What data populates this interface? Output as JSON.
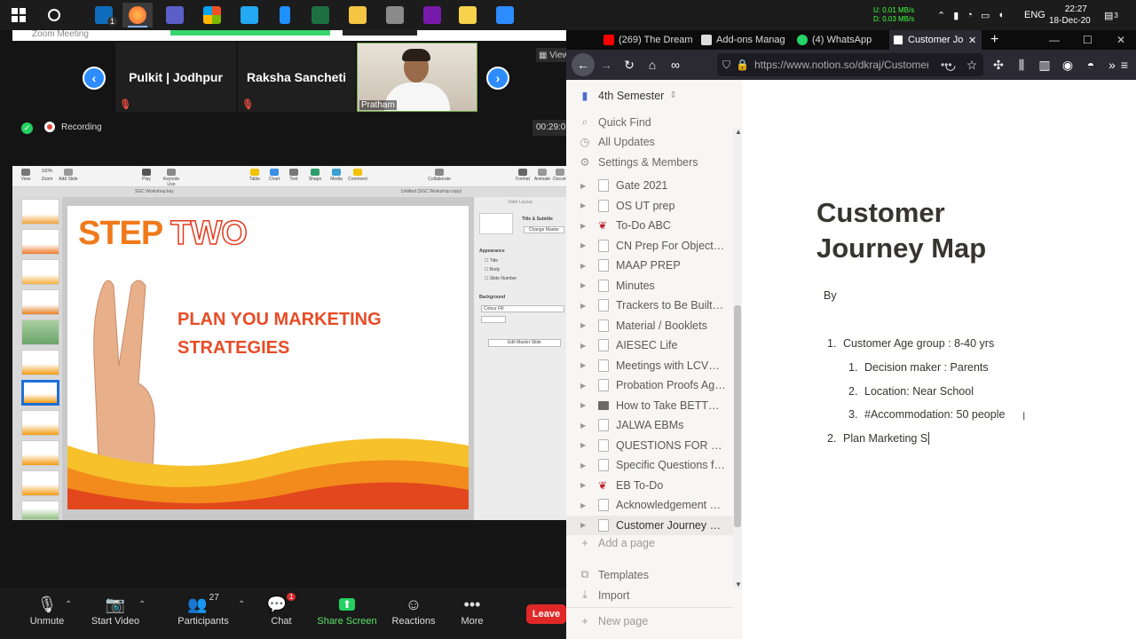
{
  "taskbar": {
    "net_up": "U:    0.01 MB/s",
    "net_down": "D:    0.03 MB/s",
    "language": "ENG",
    "time": "22:27",
    "date": "18-Dec-20",
    "notif_count": "3",
    "outlook_badge": "1"
  },
  "zoom": {
    "window_title": "Zoom Meeting",
    "view_label": "View",
    "participants": [
      {
        "name": "Pulkit | Jodhpur"
      },
      {
        "name": "Raksha Sancheti"
      }
    ],
    "video_participant": "Pratham",
    "recording_label": "Recording",
    "timer": "00:29:0",
    "controls": {
      "unmute": "Unmute",
      "start_video": "Start Video",
      "participants": "Participants",
      "participant_count": "27",
      "chat": "Chat",
      "chat_badge": "1",
      "share_screen": "Share Screen",
      "reactions": "Reactions",
      "more": "More",
      "leave": "Leave"
    }
  },
  "keynote": {
    "toolbar": {
      "view": "View",
      "zoom": "Zoom",
      "zoom_value": "100%",
      "add_slide": "Add Slide",
      "play": "Play",
      "keynote_live": "Keynote Live",
      "table": "Table",
      "chart": "Chart",
      "text": "Text",
      "shape": "Shape",
      "media": "Media",
      "comment": "Comment",
      "collaborate": "Collaborate",
      "format": "Format",
      "animate": "Animate",
      "document": "Docum"
    },
    "tabs": [
      "SGC Workshop.key",
      "Untitled (SGC Workshop copy)"
    ],
    "slide": {
      "title_part1": "STEP",
      "title_part2": "TWO",
      "body_line1": "PLAN YOU MARKETING",
      "body_line2": "STRATEGIES"
    },
    "inspector": {
      "header": "Slide Layout",
      "master": "Title & Subtitle",
      "change_master": "Change Master",
      "appearance": "Appearance",
      "title": "Title",
      "body": "Body",
      "slide_number": "Slide Number",
      "background": "Background",
      "fill": "Colour Fill",
      "edit_master": "Edit Master Slide"
    }
  },
  "firefox": {
    "tabs": [
      {
        "label": "(269) The Dream"
      },
      {
        "label": "Add-ons Manag"
      },
      {
        "label": "(4) WhatsApp"
      },
      {
        "label": "Customer Jo"
      }
    ],
    "url": "https://www.notion.so/dkraj/Customer"
  },
  "notion": {
    "workspace": "4th Semester",
    "quick_find": "Quick Find",
    "all_updates": "All Updates",
    "settings": "Settings & Members",
    "pages": [
      {
        "label": "Gate 2021",
        "icon": "page"
      },
      {
        "label": "OS UT prep",
        "icon": "page"
      },
      {
        "label": "To-Do ABC",
        "icon": "bow"
      },
      {
        "label": "CN Prep For Objective",
        "icon": "page"
      },
      {
        "label": "MAAP PREP",
        "icon": "page"
      },
      {
        "label": "Minutes",
        "icon": "page"
      },
      {
        "label": "Trackers to Be Built for",
        "icon": "page"
      },
      {
        "label": "Material / Booklets",
        "icon": "page"
      },
      {
        "label": "AIESEC Life",
        "icon": "page"
      },
      {
        "label": "Meetings with LCVP P...",
        "icon": "page"
      },
      {
        "label": "Probation Proofs Agai...",
        "icon": "page"
      },
      {
        "label": "How to Take BETTER ...",
        "icon": "image"
      },
      {
        "label": "JALWA EBMs",
        "icon": "page"
      },
      {
        "label": "QUESTIONS FOR LCV...",
        "icon": "page"
      },
      {
        "label": "Specific Questions for...",
        "icon": "page"
      },
      {
        "label": "EB To-Do",
        "icon": "bow"
      },
      {
        "label": "Acknowledgement of ...",
        "icon": "page"
      },
      {
        "label": "Customer Journey M...",
        "icon": "page"
      }
    ],
    "add_page": "Add a page",
    "templates": "Templates",
    "import": "Import",
    "new_page": "New page",
    "page_title_line1": "Customer",
    "page_title_line2": "Journey Map",
    "by": "By",
    "list": [
      {
        "num": "1.",
        "text": "Customer Age group : 8-40 yrs"
      },
      {
        "num": "1.",
        "text": "Decision maker : Parents"
      },
      {
        "num": "2.",
        "text": "Location: Near School"
      },
      {
        "num": "3.",
        "text": "#Accommodation: 50 people"
      },
      {
        "num": "2.",
        "text": "Plan Marketing S"
      }
    ]
  }
}
